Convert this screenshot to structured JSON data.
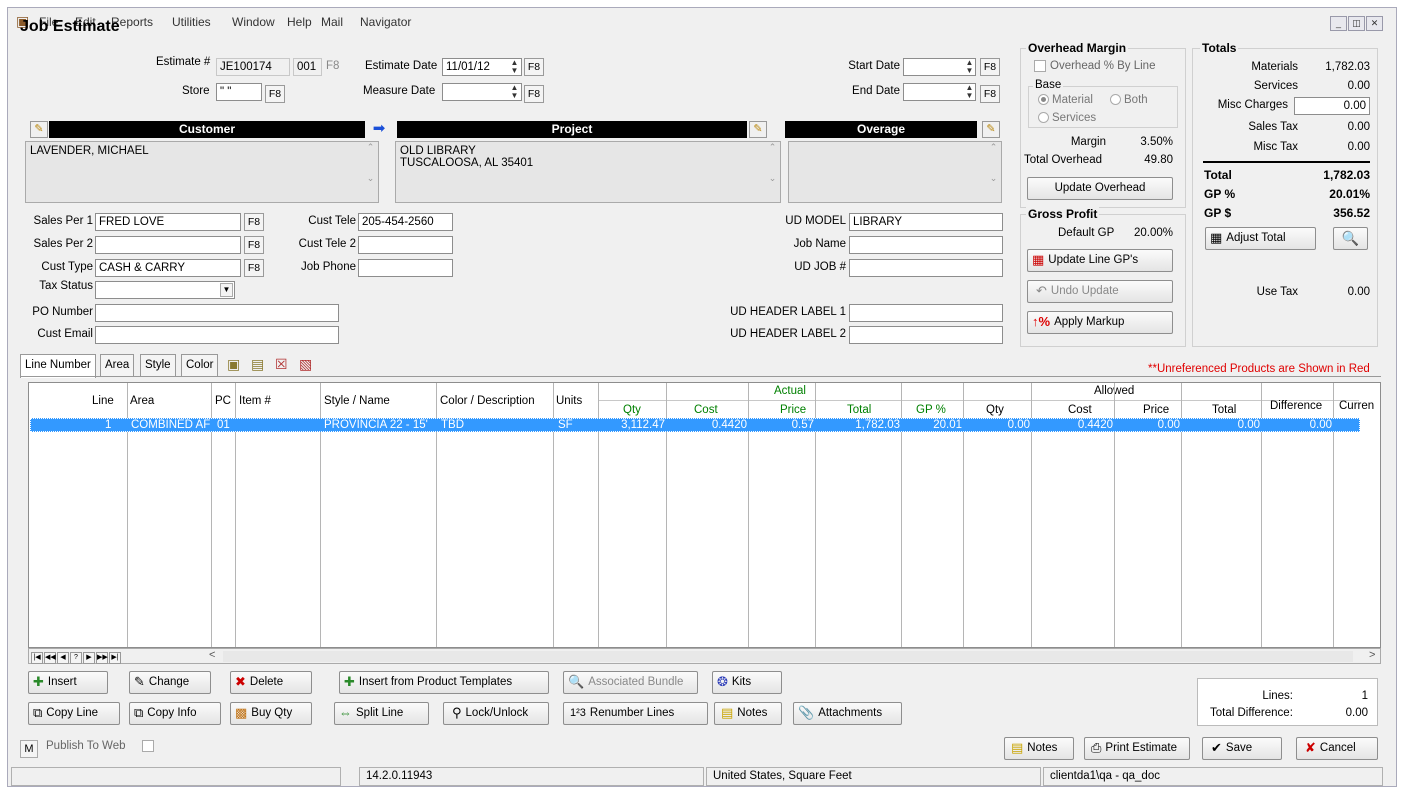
{
  "menu": [
    "File",
    "Edit",
    "Reports",
    "Utilities",
    "Window",
    "Help",
    "Mail",
    "Navigator"
  ],
  "title": "Job Estimate",
  "header": {
    "estimate_label": "Estimate #",
    "estimate_no": "JE100174",
    "estimate_suffix": "001",
    "f8": "F8",
    "estimate_date_label": "Estimate Date",
    "estimate_date": "11/01/12",
    "start_date_label": "Start Date",
    "start_date": "",
    "store_label": "Store",
    "store": "\" \"",
    "measure_date_label": "Measure Date",
    "measure_date": "",
    "end_date_label": "End Date",
    "end_date": ""
  },
  "customer": {
    "title": "Customer",
    "text": "LAVENDER, MICHAEL"
  },
  "project": {
    "title": "Project",
    "text": "OLD LIBRARY\nTUSCALOOSA, AL 35401"
  },
  "overage": {
    "title": "Overage",
    "text": ""
  },
  "fields": {
    "sales_per1_label": "Sales Per 1",
    "sales_per1": "FRED LOVE",
    "sales_per2_label": "Sales Per 2",
    "sales_per2": "",
    "cust_type_label": "Cust Type",
    "cust_type": "CASH & CARRY",
    "tax_status_label": "Tax Status",
    "tax_status": "",
    "po_number_label": "PO Number",
    "po_number": "",
    "cust_email_label": "Cust Email",
    "cust_email": "",
    "cust_tele_label": "Cust Tele",
    "cust_tele": "205-454-2560",
    "cust_tele2_label": "Cust Tele 2",
    "cust_tele2": "",
    "job_phone_label": "Job Phone",
    "job_phone": "",
    "ud_model_label": "UD MODEL",
    "ud_model": "LIBRARY",
    "job_name_label": "Job Name",
    "job_name": "",
    "ud_job_label": "UD JOB #",
    "ud_job": "",
    "ud_header1_label": "UD HEADER LABEL 1",
    "ud_header1": "",
    "ud_header2_label": "UD HEADER LABEL 2",
    "ud_header2": ""
  },
  "overhead": {
    "title": "Overhead Margin",
    "by_line": "Overhead % By Line",
    "base_label": "Base",
    "material": "Material",
    "both": "Both",
    "services": "Services",
    "margin_label": "Margin",
    "margin": "3.50%",
    "total_label": "Total Overhead",
    "total": "49.80",
    "update_btn": "Update Overhead"
  },
  "gross_profit": {
    "title": "Gross Profit",
    "default_label": "Default GP",
    "default": "20.00%",
    "update_line_btn": "Update Line GP's",
    "undo_btn": "Undo Update",
    "apply_markup_btn": "Apply Markup"
  },
  "totals": {
    "title": "Totals",
    "materials_label": "Materials",
    "materials": "1,782.03",
    "services_label": "Services",
    "services": "0.00",
    "misc_charges_label": "Misc Charges",
    "misc_charges": "0.00",
    "sales_tax_label": "Sales Tax",
    "sales_tax": "0.00",
    "misc_tax_label": "Misc Tax",
    "misc_tax": "0.00",
    "total_label": "Total",
    "total": "1,782.03",
    "gp_pct_label": "GP %",
    "gp_pct": "20.01%",
    "gp_dollar_label": "GP $",
    "gp_dollar": "356.52",
    "adjust_btn": "Adjust Total",
    "use_tax_label": "Use Tax",
    "use_tax": "0.00"
  },
  "tabs": [
    "Line Number",
    "Area",
    "Style",
    "Color"
  ],
  "unreferenced_note": "**Unreferenced Products are Shown in Red",
  "grid": {
    "group_actual": "Actual",
    "group_allowed": "Allowed",
    "columns": [
      "Line",
      "Area",
      "PC",
      "Item #",
      "Style / Name",
      "Color / Description",
      "Units",
      "Qty",
      "Cost",
      "Price",
      "Total",
      "GP %",
      "Qty",
      "Cost",
      "Price",
      "Total",
      "Difference",
      "Curren"
    ],
    "row": [
      "1",
      "COMBINED AF",
      "01",
      "",
      "PROVINCIA 22 - 15'",
      "TBD",
      "SF",
      "3,112.47",
      "0.4420",
      "0.57",
      "1,782.03",
      "20.01",
      "0.00",
      "0.4420",
      "0.00",
      "0.00",
      "0.00",
      ""
    ]
  },
  "buttons": {
    "insert": "Insert",
    "change": "Change",
    "delete": "Delete",
    "insert_templates": "Insert from Product Templates",
    "associated_bundle": "Associated Bundle",
    "kits": "Kits",
    "copy_line": "Copy Line",
    "copy_info": "Copy Info",
    "buy_qty": "Buy Qty",
    "split_line": "Split Line",
    "lock_unlock": "Lock/Unlock",
    "renumber": "Renumber Lines",
    "notes": "Notes",
    "attachments": "Attachments"
  },
  "summary": {
    "lines_label": "Lines:",
    "lines": "1",
    "diff_label": "Total Difference:",
    "diff": "0.00"
  },
  "footer": {
    "m": "M",
    "publish": "Publish To Web",
    "notes": "Notes",
    "print": "Print Estimate",
    "save": "Save",
    "cancel": "Cancel"
  },
  "status": {
    "version": "14.2.0.11943",
    "region": "United States, Square Feet",
    "user": "clientda1\\qa - qa_doc"
  }
}
